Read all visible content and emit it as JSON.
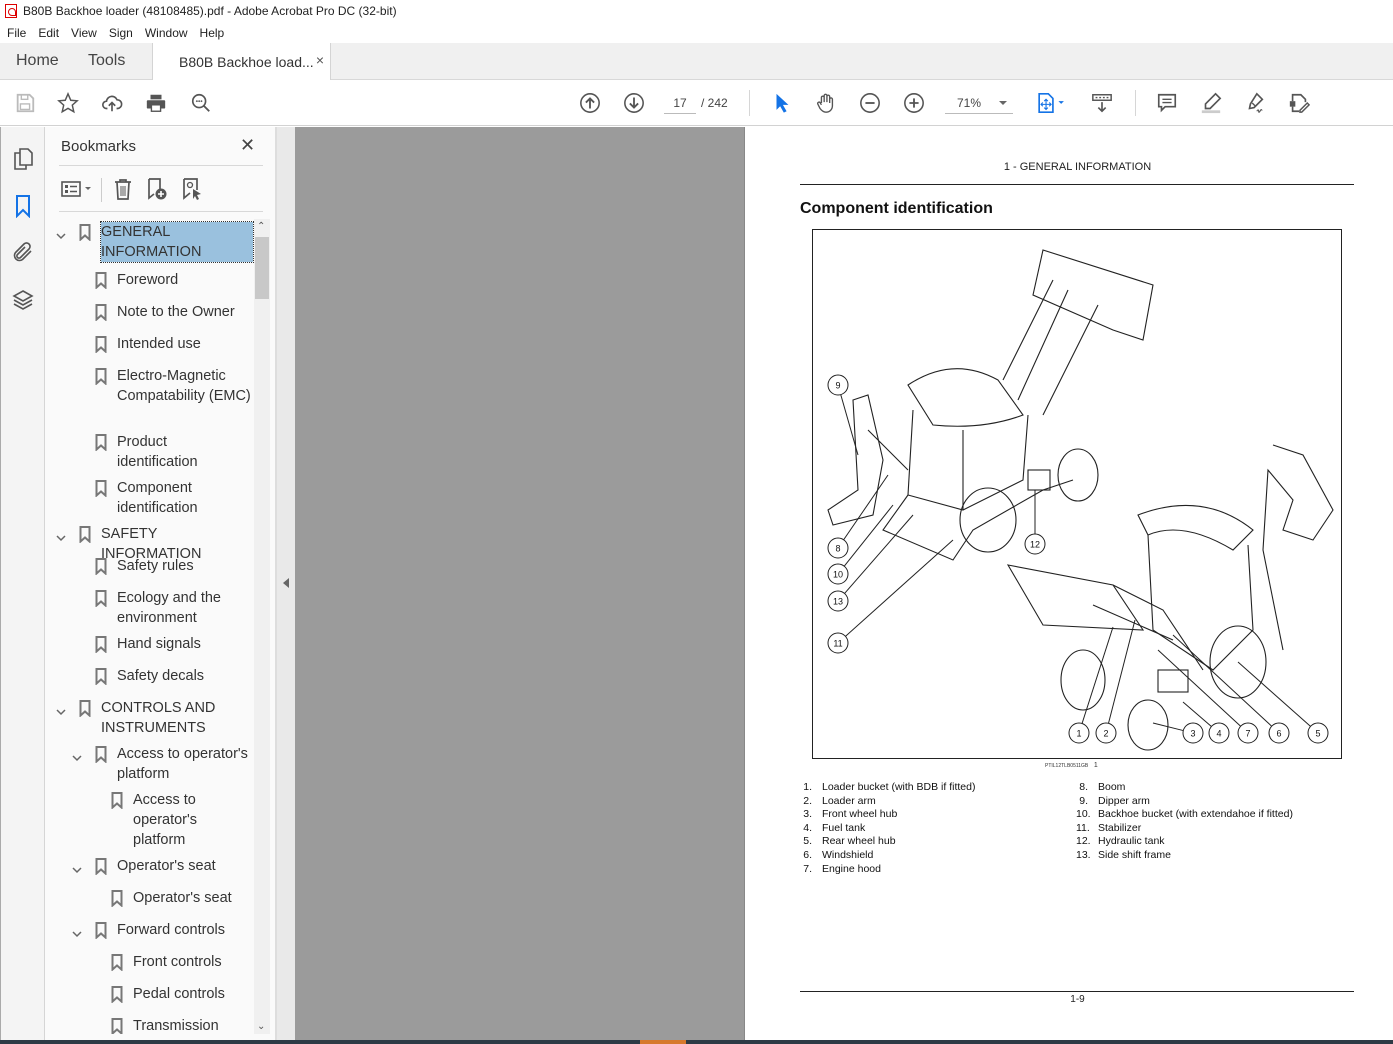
{
  "window": {
    "title": "B80B Backhoe loader (48108485).pdf - Adobe Acrobat Pro DC (32-bit)"
  },
  "menu": [
    "File",
    "Edit",
    "View",
    "Sign",
    "Window",
    "Help"
  ],
  "tabs": {
    "home": "Home",
    "tools": "Tools",
    "document": "B80B Backhoe load...",
    "close": "×"
  },
  "toolbar": {
    "current_page": "17",
    "total_pages": "/ 242",
    "zoom": "71%"
  },
  "bookmarks": {
    "title": "Bookmarks",
    "close": "✕",
    "items": [
      {
        "label": "GENERAL INFORMATION",
        "level": 0,
        "expanded": true,
        "selected": true
      },
      {
        "label": "Foreword",
        "level": 1
      },
      {
        "label": "Note to the Owner",
        "level": 1
      },
      {
        "label": "Intended use",
        "level": 1
      },
      {
        "label": "Electro-Magnetic Compatability (EMC)",
        "level": 1
      },
      {
        "label": "Product identification",
        "level": 1
      },
      {
        "label": "Component identification",
        "level": 1
      },
      {
        "label": "SAFETY INFORMATION",
        "level": 0,
        "expanded": true
      },
      {
        "label": "Safety rules",
        "level": 1
      },
      {
        "label": "Ecology and the environment",
        "level": 1
      },
      {
        "label": "Hand signals",
        "level": 1
      },
      {
        "label": "Safety decals",
        "level": 1
      },
      {
        "label": "CONTROLS AND INSTRUMENTS",
        "level": 0,
        "expanded": true
      },
      {
        "label": "Access to operator's platform",
        "level": 1,
        "expanded": true
      },
      {
        "label": "Access to operator's platform",
        "level": 2
      },
      {
        "label": "Operator's seat",
        "level": 1,
        "expanded": true
      },
      {
        "label": "Operator's seat",
        "level": 2
      },
      {
        "label": "Forward controls",
        "level": 1,
        "expanded": true
      },
      {
        "label": "Front controls",
        "level": 2
      },
      {
        "label": "Pedal controls",
        "level": 2
      },
      {
        "label": "Transmission",
        "level": 2
      }
    ]
  },
  "document": {
    "running_header": "1 - GENERAL INFORMATION",
    "heading": "Component identification",
    "figure_code": "PTIL12TLB0511GB",
    "figure_number": "1",
    "callouts": [
      "1",
      "2",
      "3",
      "4",
      "5",
      "6",
      "7",
      "8",
      "9",
      "10",
      "11",
      "12",
      "13"
    ],
    "legend_left": [
      {
        "n": "1.",
        "text": "Loader bucket (with BDB if fitted)"
      },
      {
        "n": "2.",
        "text": "Loader arm"
      },
      {
        "n": "3.",
        "text": "Front wheel hub"
      },
      {
        "n": "4.",
        "text": "Fuel tank"
      },
      {
        "n": "5.",
        "text": "Rear wheel hub"
      },
      {
        "n": "6.",
        "text": "Windshield"
      },
      {
        "n": "7.",
        "text": "Engine hood"
      }
    ],
    "legend_right": [
      {
        "n": "8.",
        "text": "Boom"
      },
      {
        "n": "9.",
        "text": "Dipper arm"
      },
      {
        "n": "10.",
        "text": "Backhoe bucket (with extendahoe if fitted)"
      },
      {
        "n": "11.",
        "text": "Stabilizer"
      },
      {
        "n": "12.",
        "text": "Hydraulic tank"
      },
      {
        "n": "13.",
        "text": "Side shift frame"
      }
    ],
    "page_number": "1-9"
  },
  "colors": {
    "accent": "#1473e6",
    "selection": "#9ac1de",
    "canvas": "#9b9b9b"
  }
}
